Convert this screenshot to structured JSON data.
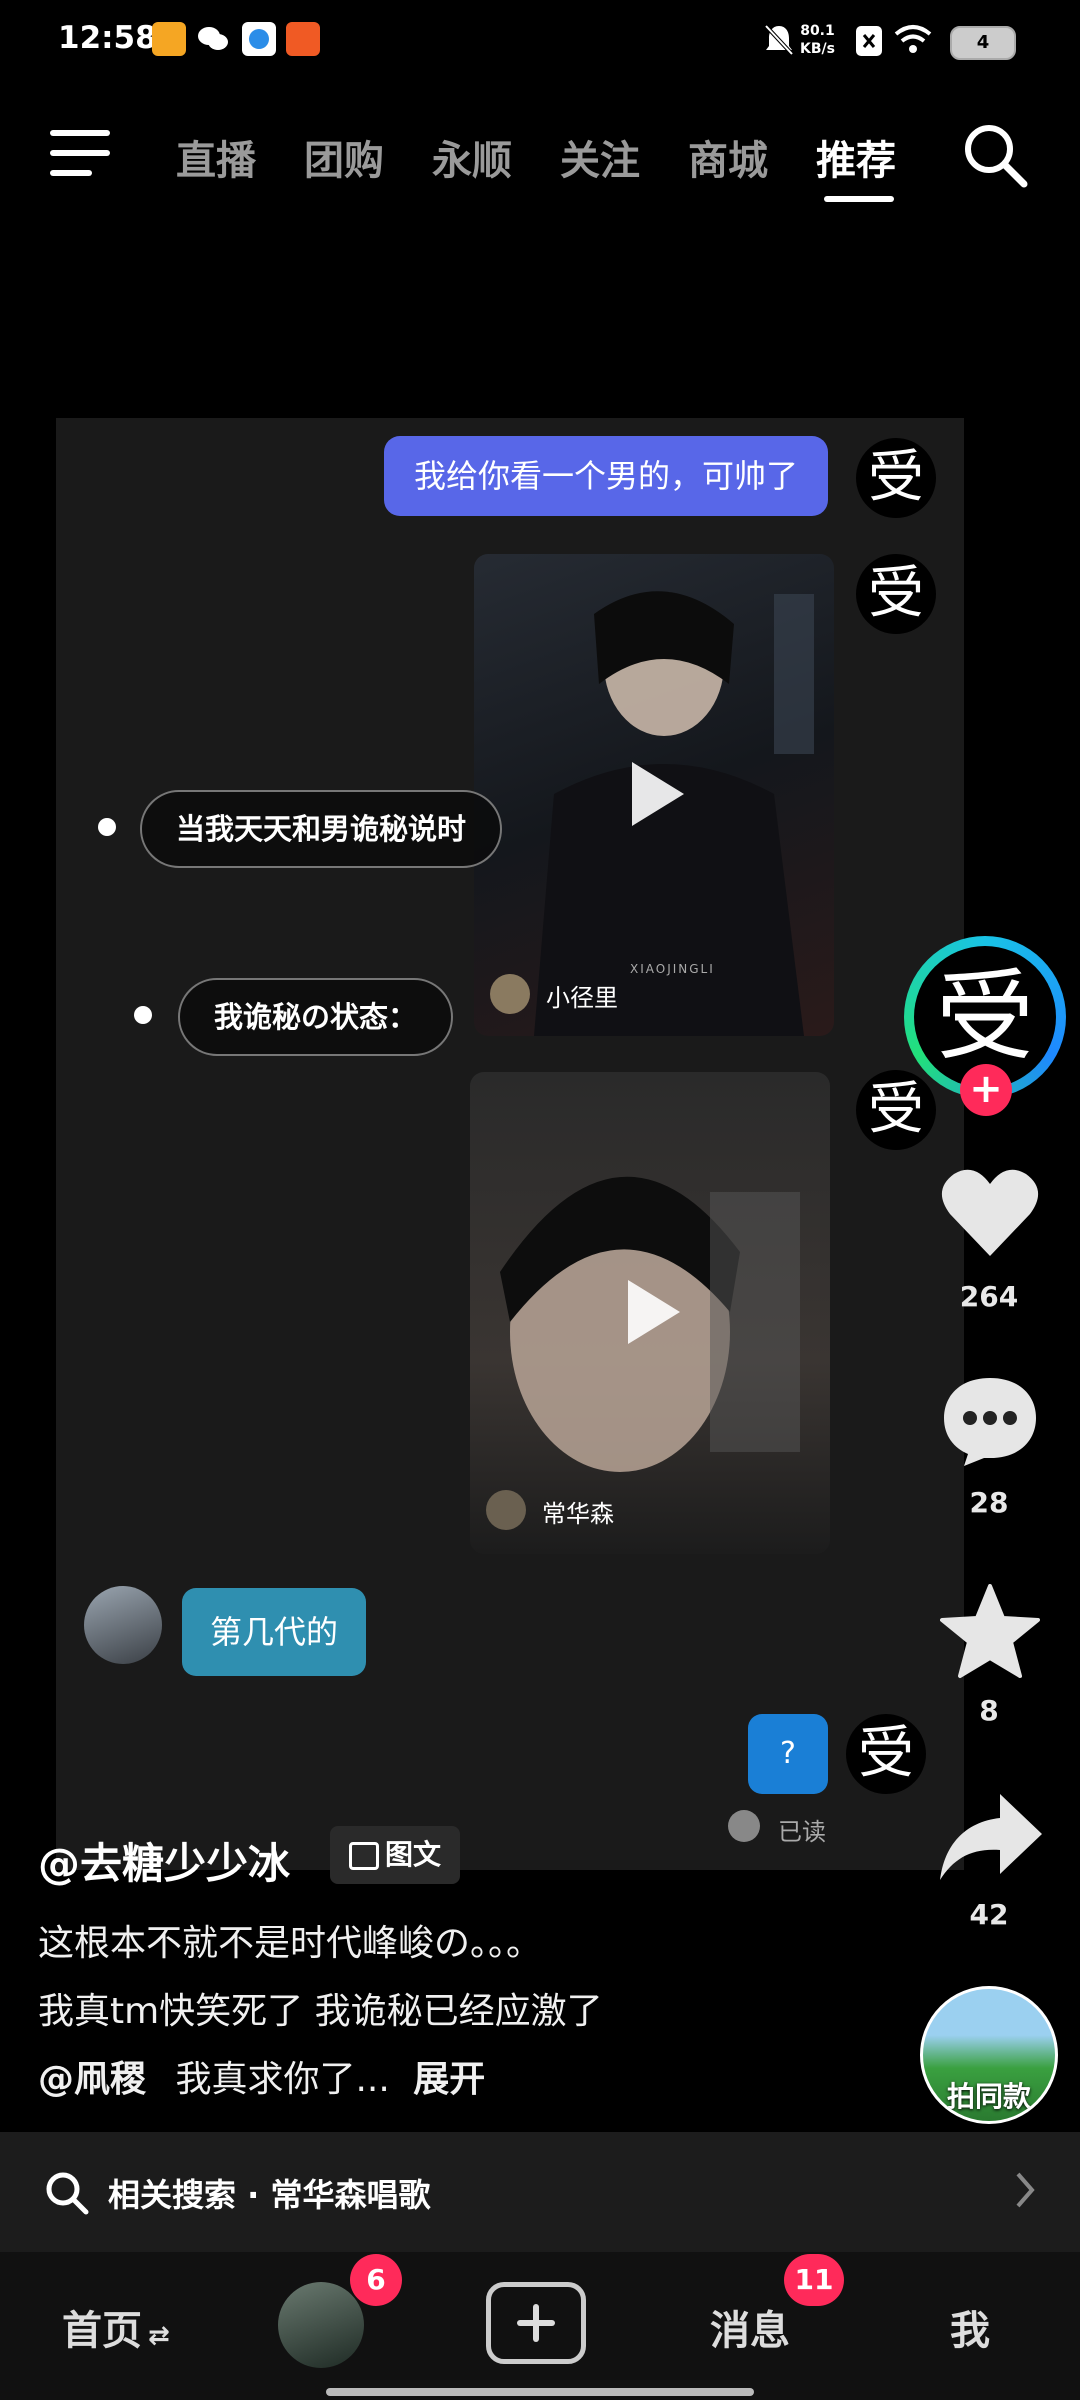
{
  "status_bar": {
    "time": "12:58",
    "net_speed_value": "80.1",
    "net_speed_unit": "KB/s",
    "battery": "4"
  },
  "top_nav": {
    "tabs": [
      "直播",
      "团购",
      "永顺",
      "关注",
      "商城",
      "推荐"
    ],
    "active_tab": "推荐"
  },
  "chat": {
    "message_1": "我给你看一个男的，可帅了",
    "ai_avatar_char": "受",
    "video_1_author": "小径里",
    "video_1_watermark": "XIAOJINGLI",
    "video_2_author": "常华森",
    "reply_text": "第几代的",
    "question_mark": "?",
    "read_status": "已读",
    "overlay_1": "当我天天和男诡秘说时",
    "overlay_2": "我诡秘の状态："
  },
  "right_rail": {
    "creator_avatar_char": "受",
    "likes": "264",
    "comments": "28",
    "favorites": "8",
    "shares": "42",
    "same_style_label": "拍同款"
  },
  "caption": {
    "author": "@去糖少少冰",
    "tag": "图文",
    "line1": "这根本不就不是时代峰峻の。。。",
    "line2": "我真tm快笑死了  我诡秘已经应激了",
    "line3_mention": "@凧稷",
    "line3_text": "我真求你了...",
    "expand": "展开"
  },
  "related_search": {
    "label": "相关搜索 · 常华森唱歌"
  },
  "bottom_nav": {
    "home": "首页",
    "friends_badge": "6",
    "messages": "消息",
    "messages_badge": "11",
    "me": "我"
  },
  "colors": {
    "accent_bubble": "#5867e8",
    "reply_bubble": "#2f8fb0",
    "badge": "#ff2a5a"
  }
}
